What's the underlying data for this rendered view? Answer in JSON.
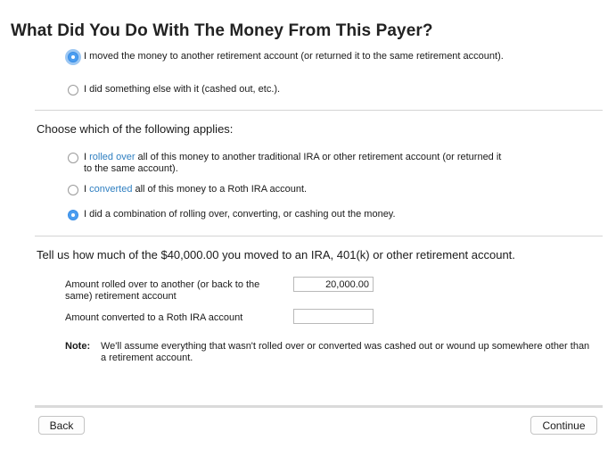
{
  "page": {
    "title": "What Did You Do With The Money From This Payer?"
  },
  "money_question": {
    "options": [
      {
        "label": "I moved the money to another retirement account (or returned it to the same retirement account).",
        "selected": true
      },
      {
        "label": "I did something else with it (cashed out, etc.).",
        "selected": false
      }
    ]
  },
  "applies_section": {
    "heading": "Choose which of the following applies:",
    "options": [
      {
        "prefix": "I ",
        "link": "rolled over",
        "suffix": " all of this money to another traditional IRA or other retirement account (or returned it to the same account).",
        "selected": false
      },
      {
        "prefix": "I ",
        "link": "converted",
        "suffix": " all of this money to a Roth IRA account.",
        "selected": false
      },
      {
        "label": "I did a combination of rolling over, converting, or cashing out the money.",
        "selected": true
      }
    ]
  },
  "amount_section": {
    "heading": "Tell us how much of the $40,000.00 you moved to an IRA, 401(k) or other retirement account.",
    "rolled_over": {
      "label": "Amount rolled over to another (or back to the same) retirement account",
      "value": "20,000.00"
    },
    "converted": {
      "label": "Amount converted to a Roth IRA account",
      "value": ""
    },
    "note": {
      "label": "Note:",
      "text": "We'll assume everything that wasn't rolled over or converted was cashed out or wound up somewhere other than a retirement account."
    }
  },
  "footer": {
    "back_label": "Back",
    "continue_label": "Continue"
  },
  "colors": {
    "accent": "#4a9df0",
    "link": "#2f7fc1"
  }
}
